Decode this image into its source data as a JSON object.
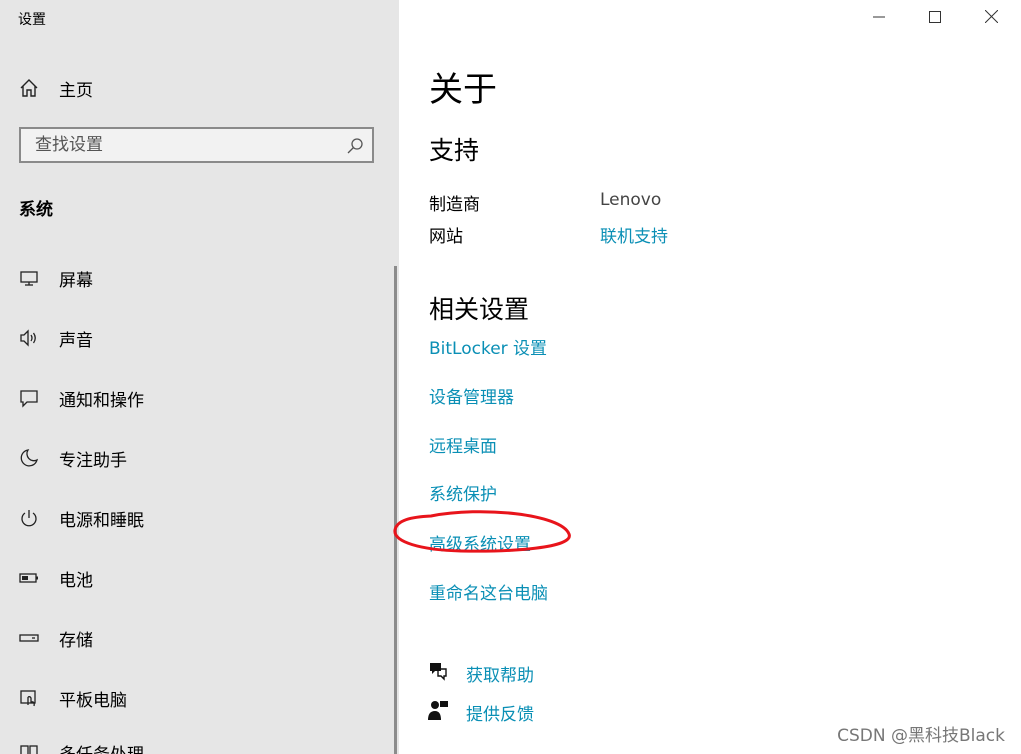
{
  "app": {
    "title": "设置"
  },
  "sidebar": {
    "home_label": "主页",
    "search_placeholder": "查找设置",
    "section_label": "系统",
    "items": [
      {
        "label": "屏幕",
        "icon": "monitor-icon"
      },
      {
        "label": "声音",
        "icon": "speaker-icon"
      },
      {
        "label": "通知和操作",
        "icon": "notification-icon"
      },
      {
        "label": "专注助手",
        "icon": "moon-icon"
      },
      {
        "label": "电源和睡眠",
        "icon": "power-icon"
      },
      {
        "label": "电池",
        "icon": "battery-icon"
      },
      {
        "label": "存储",
        "icon": "storage-icon"
      },
      {
        "label": "平板电脑",
        "icon": "tablet-icon"
      },
      {
        "label": "多任务处理",
        "icon": "multitask-icon"
      }
    ]
  },
  "main": {
    "title": "关于",
    "support": {
      "heading": "支持",
      "manufacturer_label": "制造商",
      "manufacturer_value": "Lenovo",
      "website_label": "网站",
      "website_link": "联机支持"
    },
    "related": {
      "heading": "相关设置",
      "links": [
        "BitLocker 设置",
        "设备管理器",
        "远程桌面",
        "系统保护",
        "高级系统设置",
        "重命名这台电脑"
      ]
    },
    "help": {
      "get_help": "获取帮助",
      "feedback": "提供反馈"
    }
  },
  "watermark": "CSDN @黑科技Black",
  "colors": {
    "link": "#0a8fb5",
    "sidebar_bg": "#e6e6e6",
    "annotation": "#e8141b"
  }
}
